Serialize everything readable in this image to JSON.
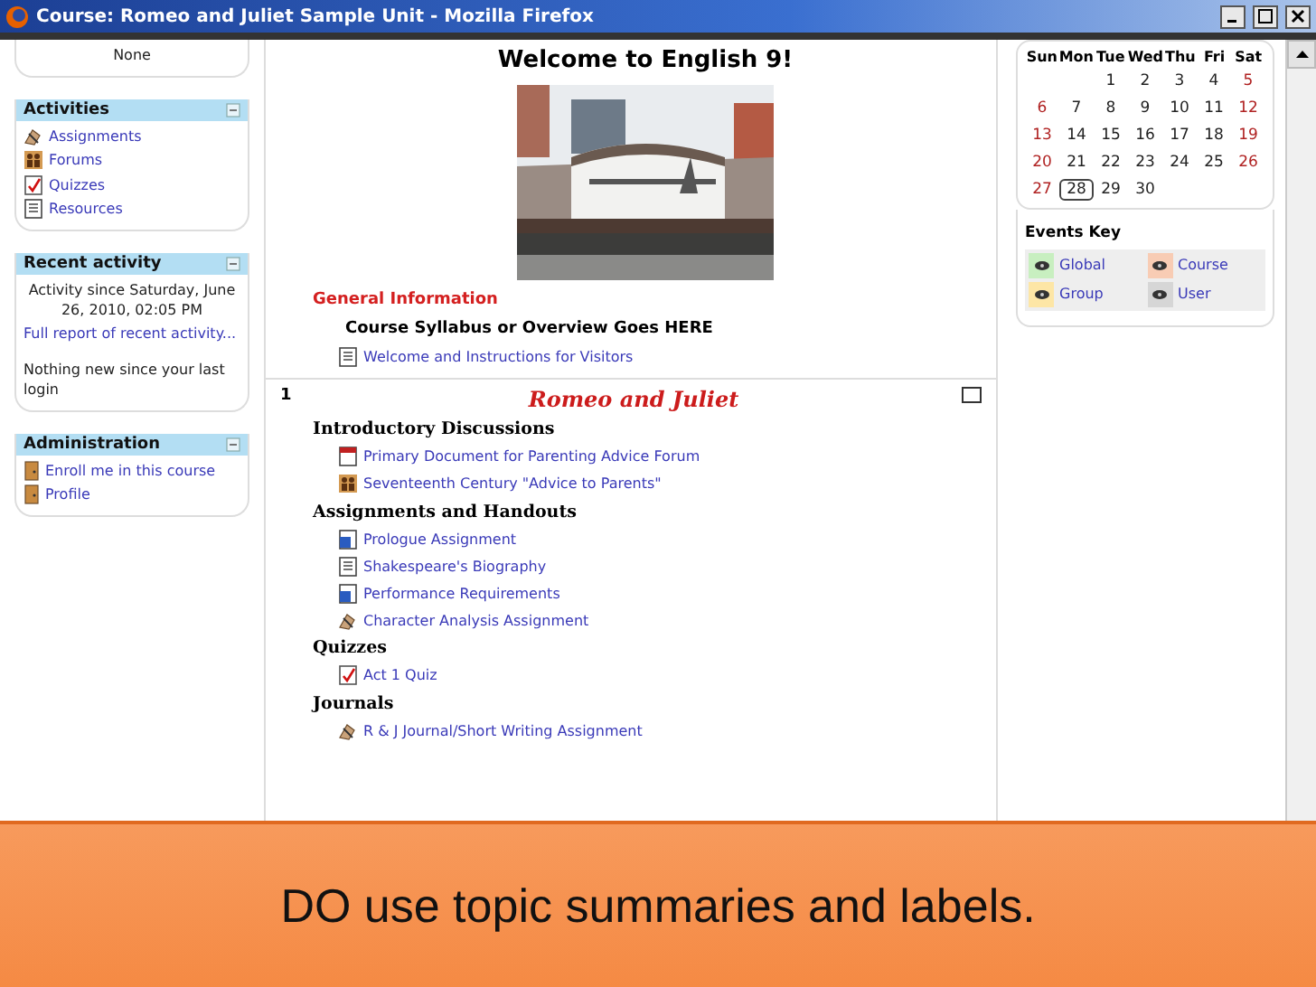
{
  "window": {
    "title": "Course: Romeo and Juliet Sample Unit - Mozilla Firefox"
  },
  "left_blocks": [
    {
      "kind": "plain",
      "lines": [
        {
          "kind": "text",
          "text": "None"
        }
      ]
    },
    {
      "kind": "block",
      "title": "Activities",
      "lines": [
        {
          "kind": "assignment",
          "text": "Assignments"
        },
        {
          "kind": "forum",
          "text": "Forums"
        },
        {
          "kind": "quiz",
          "text": "Quizzes"
        },
        {
          "kind": "resource",
          "text": "Resources"
        }
      ]
    },
    {
      "kind": "block",
      "title": "Recent activity",
      "lines": [
        {
          "kind": "center",
          "text": "Activity since Saturday, June 26, 2010, 02:05 PM"
        },
        {
          "kind": "link",
          "text": "Full report of recent activity..."
        },
        {
          "kind": "text",
          "text": "Nothing new since your last login"
        }
      ]
    },
    {
      "kind": "block",
      "title": "Administration",
      "lines": [
        {
          "kind": "admin",
          "text": "Enroll me in this course"
        },
        {
          "kind": "admin",
          "text": "Profile"
        }
      ]
    }
  ],
  "summary": {
    "heading": "Welcome to English 9!",
    "section_title": "General Information",
    "note": "Course Syllabus or Overview Goes HERE",
    "link": {
      "kind": "resource",
      "text": "Welcome and Instructions for Visitors"
    }
  },
  "topic": {
    "number": "1",
    "title": "Romeo and Juliet",
    "groups": [
      {
        "label": "Introductory Discussions",
        "items": [
          {
            "kind": "pdf",
            "text": "Primary Document for Parenting Advice Forum"
          },
          {
            "kind": "forum",
            "text": "Seventeenth Century \"Advice to Parents\""
          }
        ]
      },
      {
        "label": "Assignments and Handouts",
        "items": [
          {
            "kind": "word",
            "text": "Prologue Assignment"
          },
          {
            "kind": "resource",
            "text": "Shakespeare's Biography"
          },
          {
            "kind": "word",
            "text": "Performance Requirements"
          },
          {
            "kind": "assignment",
            "text": "Character Analysis Assignment"
          }
        ]
      },
      {
        "label": "Quizzes",
        "items": [
          {
            "kind": "quiz",
            "text": "Act 1 Quiz"
          }
        ]
      },
      {
        "label": "Journals",
        "items": [
          {
            "kind": "assignment",
            "text": "R & J Journal/Short Writing Assignment"
          }
        ]
      }
    ]
  },
  "calendar": {
    "weekdays": [
      "Sun",
      "Mon",
      "Tue",
      "Wed",
      "Thu",
      "Fri",
      "Sat"
    ],
    "weeks": [
      {
        "days": [
          {
            "text": "1",
            "weekend": false,
            "today": false
          },
          {
            "text": "2",
            "weekend": false,
            "today": false
          },
          {
            "text": "3",
            "weekend": false,
            "today": false
          },
          {
            "text": "4",
            "weekend": false,
            "today": false
          },
          {
            "text": "5",
            "weekend": true,
            "today": false
          }
        ]
      },
      {
        "days": [
          {
            "text": "6",
            "weekend": true,
            "today": false
          },
          {
            "text": "7",
            "weekend": false,
            "today": false
          },
          {
            "text": "8",
            "weekend": false,
            "today": false
          },
          {
            "text": "9",
            "weekend": false,
            "today": false
          },
          {
            "text": "10",
            "weekend": false,
            "today": false
          },
          {
            "text": "11",
            "weekend": false,
            "today": false
          },
          {
            "text": "12",
            "weekend": true,
            "today": false
          }
        ]
      },
      {
        "days": [
          {
            "text": "13",
            "weekend": true,
            "today": false
          },
          {
            "text": "14",
            "weekend": false,
            "today": false
          },
          {
            "text": "15",
            "weekend": false,
            "today": false
          },
          {
            "text": "16",
            "weekend": false,
            "today": false
          },
          {
            "text": "17",
            "weekend": false,
            "today": false
          },
          {
            "text": "18",
            "weekend": false,
            "today": false
          },
          {
            "text": "19",
            "weekend": true,
            "today": false
          }
        ]
      },
      {
        "days": [
          {
            "text": "20",
            "weekend": true,
            "today": false
          },
          {
            "text": "21",
            "weekend": false,
            "today": false
          },
          {
            "text": "22",
            "weekend": false,
            "today": false
          },
          {
            "text": "23",
            "weekend": false,
            "today": false
          },
          {
            "text": "24",
            "weekend": false,
            "today": false
          },
          {
            "text": "25",
            "weekend": false,
            "today": false
          },
          {
            "text": "26",
            "weekend": true,
            "today": false
          }
        ]
      },
      {
        "days": [
          {
            "text": "27",
            "weekend": true,
            "today": false
          },
          {
            "text": "28",
            "weekend": false,
            "today": true
          },
          {
            "text": "29",
            "weekend": false,
            "today": false
          },
          {
            "text": "30",
            "weekend": false,
            "today": false
          }
        ]
      }
    ]
  },
  "events_key": {
    "title": "Events Key",
    "items": [
      {
        "label": "Global",
        "color": "#c8efc0"
      },
      {
        "label": "Course",
        "color": "#f8ccb4"
      },
      {
        "label": "Group",
        "color": "#fde6a6"
      },
      {
        "label": "User",
        "color": "#d6d6d6"
      }
    ]
  },
  "caption": "DO use topic summaries and labels."
}
